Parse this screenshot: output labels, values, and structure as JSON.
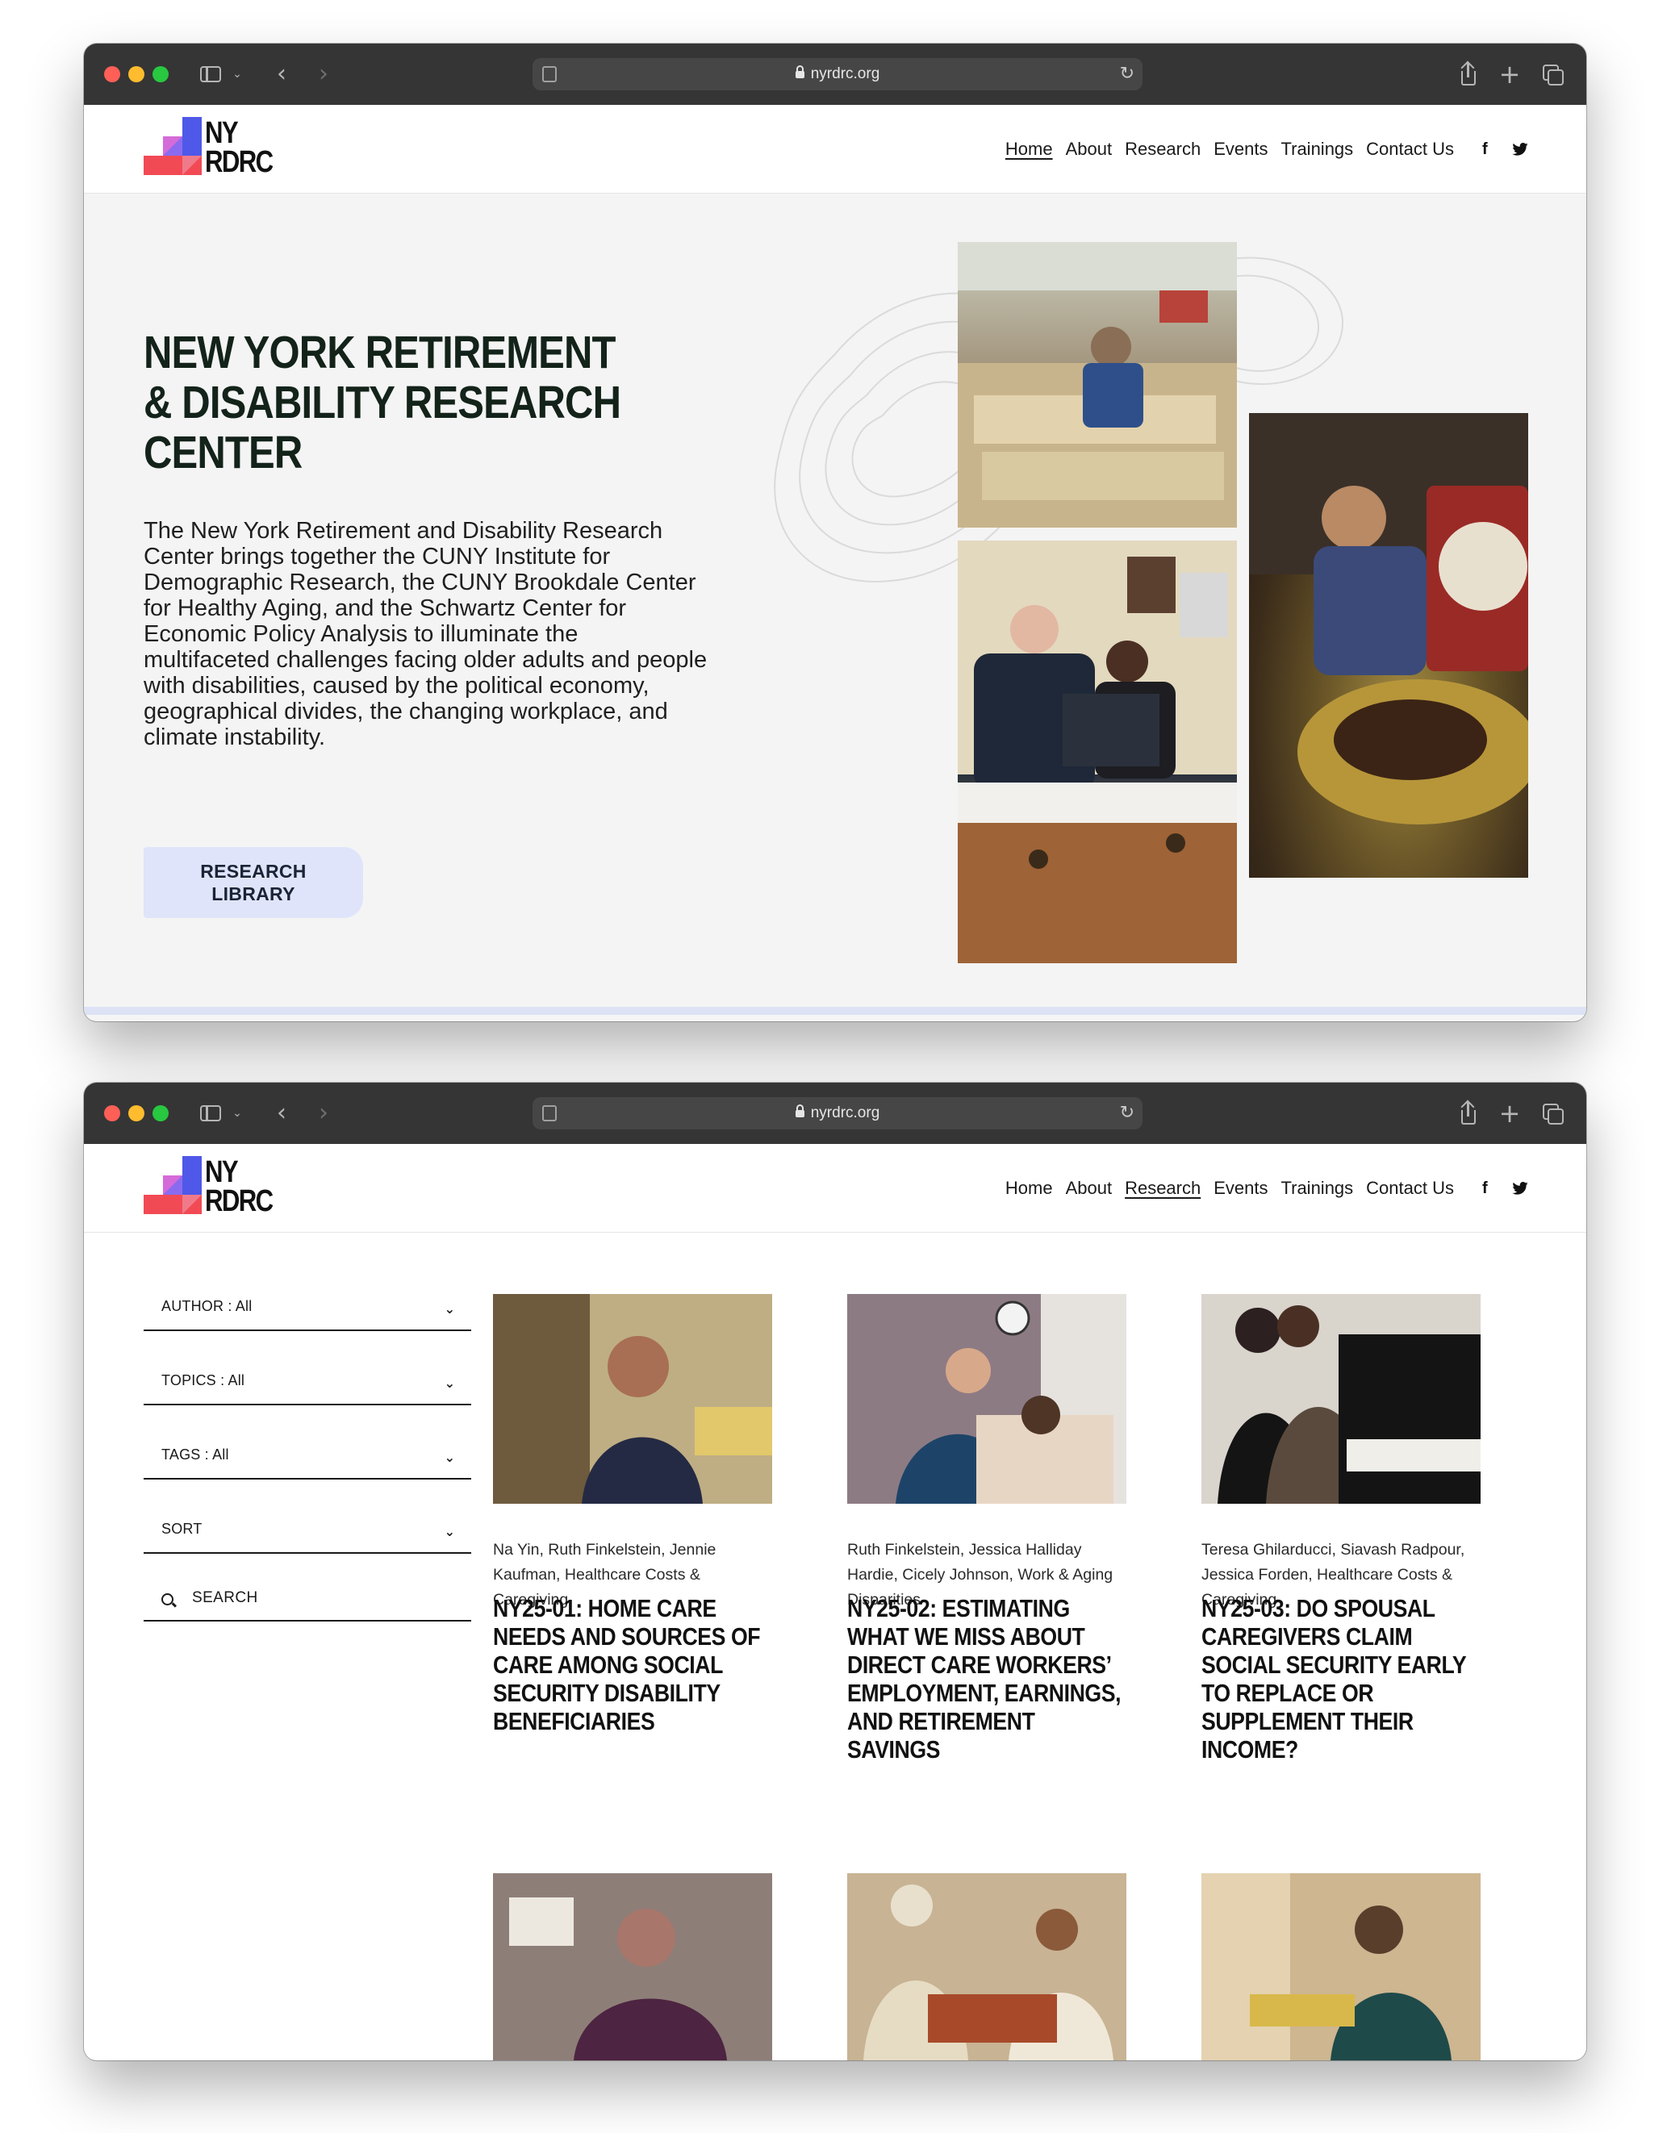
{
  "browser": {
    "url": "nyrdrc.org"
  },
  "site": {
    "logo_line1": "NY",
    "logo_line2": "RDRC",
    "nav": [
      "Home",
      "About",
      "Research",
      "Events",
      "Trainings",
      "Contact Us"
    ],
    "social": {
      "facebook": "f",
      "twitter": "✦"
    }
  },
  "home": {
    "active_nav": "Home",
    "title": "NEW YORK RETIREMENT & DISABILITY RESEARCH CENTER",
    "description": "The New York Retirement and Disability Research Center brings together the CUNY Institute for Demographic Research, the CUNY Brookdale Center for Healthy Aging, and the Schwartz Center for Economic Policy Analysis to illuminate the multifaceted challenges facing older adults and people with disabilities, caused by the political economy, geographical divides, the changing workplace, and climate instability.",
    "button_line1": "RESEARCH",
    "button_line2": "LIBRARY"
  },
  "research": {
    "active_nav": "Research",
    "filters": [
      {
        "label": "AUTHOR : All"
      },
      {
        "label": "TOPICS : All"
      },
      {
        "label": "TAGS : All"
      },
      {
        "label": "SORT"
      }
    ],
    "search_label": "SEARCH",
    "cards": [
      {
        "meta": "Na Yin, Ruth Finkelstein, Jennie Kaufman, Healthcare Costs & Caregiving",
        "title": "NY25-01: HOME CARE NEEDS AND SOURCES OF CARE AMONG SOCIAL SECURITY DISABILITY BENEFICIARIES"
      },
      {
        "meta": "Ruth Finkelstein, Jessica Halliday Hardie, Cicely Johnson, Work & Aging Disparities",
        "title": "NY25-02: ESTIMATING WHAT WE MISS ABOUT DIRECT CARE WORKERS’ EMPLOYMENT, EARNINGS, AND RETIREMENT SAVINGS"
      },
      {
        "meta": "Teresa Ghilarducci, Siavash Radpour, Jessica Forden, Healthcare Costs & Caregiving",
        "title": "NY25-03: DO SPOUSAL CAREGIVERS CLAIM SOCIAL SECURITY EARLY TO REPLACE OR SUPPLEMENT THEIR INCOME?"
      }
    ]
  },
  "icons": {
    "back": "‹",
    "forward": "›",
    "reload": "↻",
    "chevron": "⌄",
    "plus": "+"
  }
}
